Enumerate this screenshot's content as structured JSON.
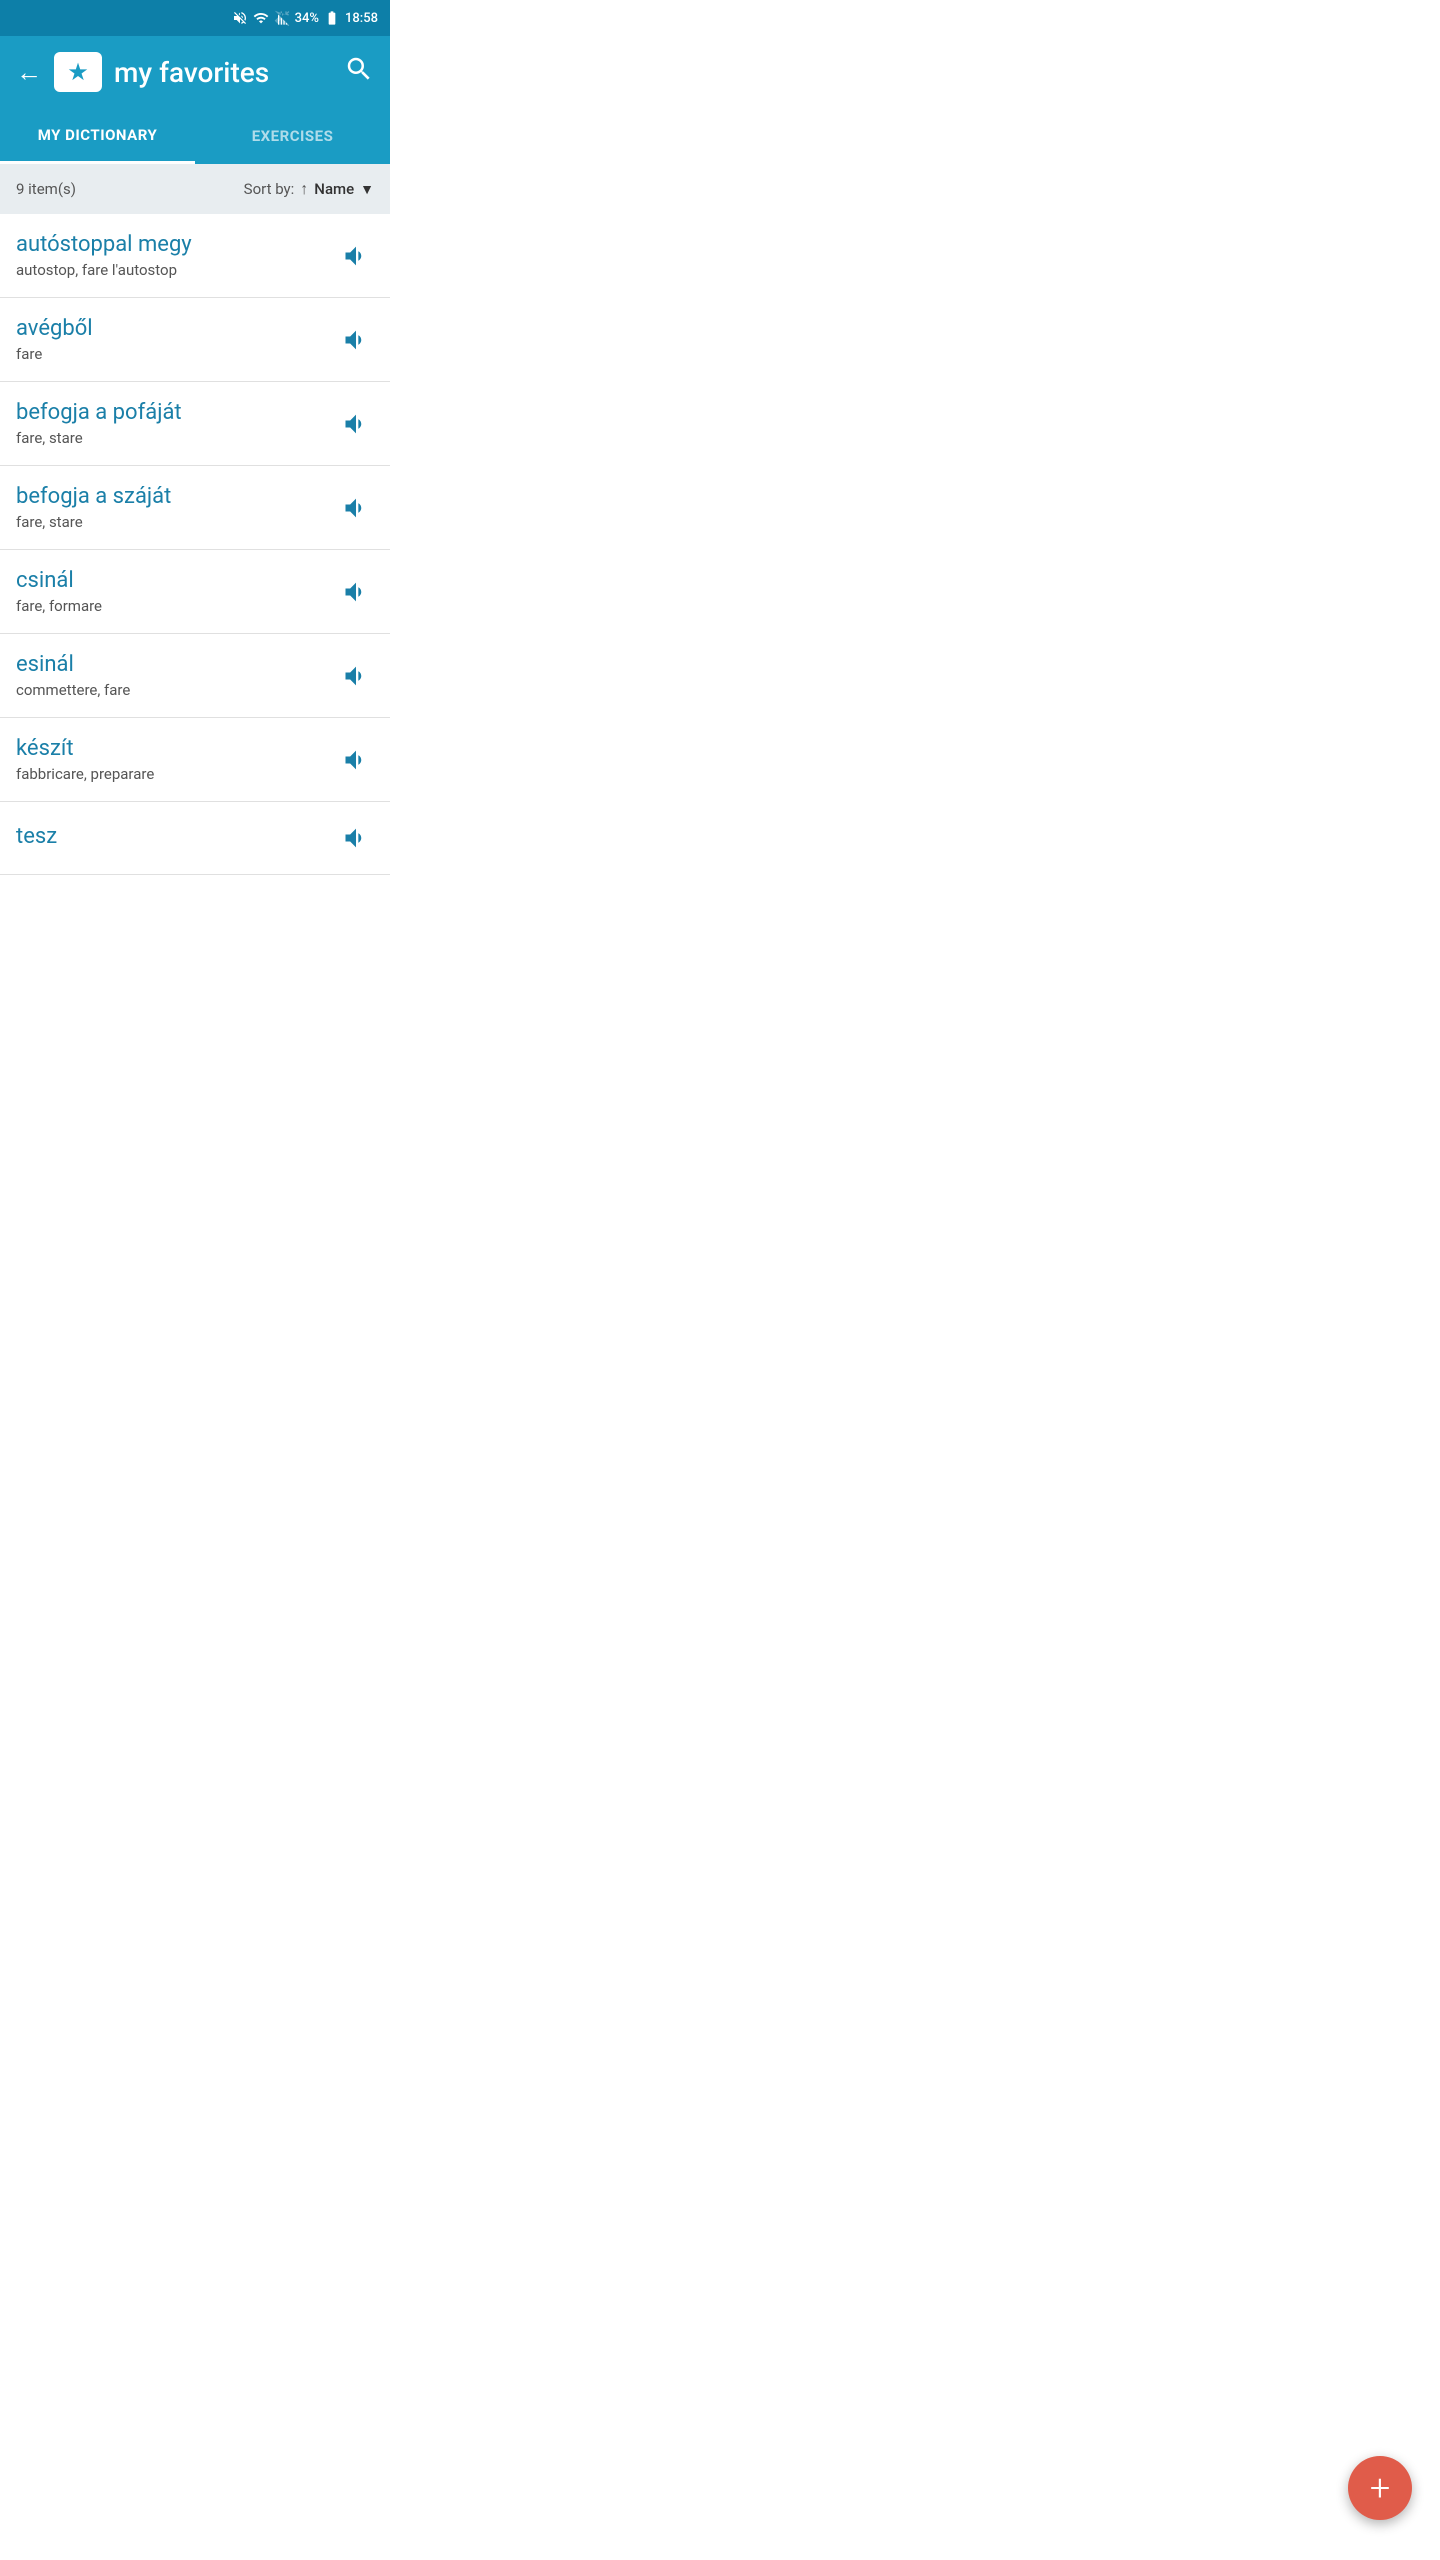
{
  "statusBar": {
    "battery": "34%",
    "time": "18:58"
  },
  "appBar": {
    "title": "my favorites",
    "backLabel": "←",
    "searchLabel": "🔍"
  },
  "tabs": [
    {
      "id": "my-dictionary",
      "label": "MY DICTIONARY",
      "active": true
    },
    {
      "id": "exercises",
      "label": "EXERCISES",
      "active": false
    }
  ],
  "sortBar": {
    "itemCount": "9 item(s)",
    "sortByLabel": "Sort by:",
    "sortField": "Name"
  },
  "words": [
    {
      "id": 1,
      "term": "autóstoppal megy",
      "translation": "autostop, fare l'autostop"
    },
    {
      "id": 2,
      "term": "avégből",
      "translation": "fare"
    },
    {
      "id": 3,
      "term": "befogja a pofáját",
      "translation": "fare, stare"
    },
    {
      "id": 4,
      "term": "befogja a száját",
      "translation": "fare, stare"
    },
    {
      "id": 5,
      "term": "csinál",
      "translation": "fare, formare"
    },
    {
      "id": 6,
      "term": "esinál",
      "translation": "commettere, fare"
    },
    {
      "id": 7,
      "term": "készít",
      "translation": "fabbricare, preparare"
    },
    {
      "id": 8,
      "term": "tesz",
      "translation": ""
    }
  ],
  "fab": {
    "label": "+"
  }
}
